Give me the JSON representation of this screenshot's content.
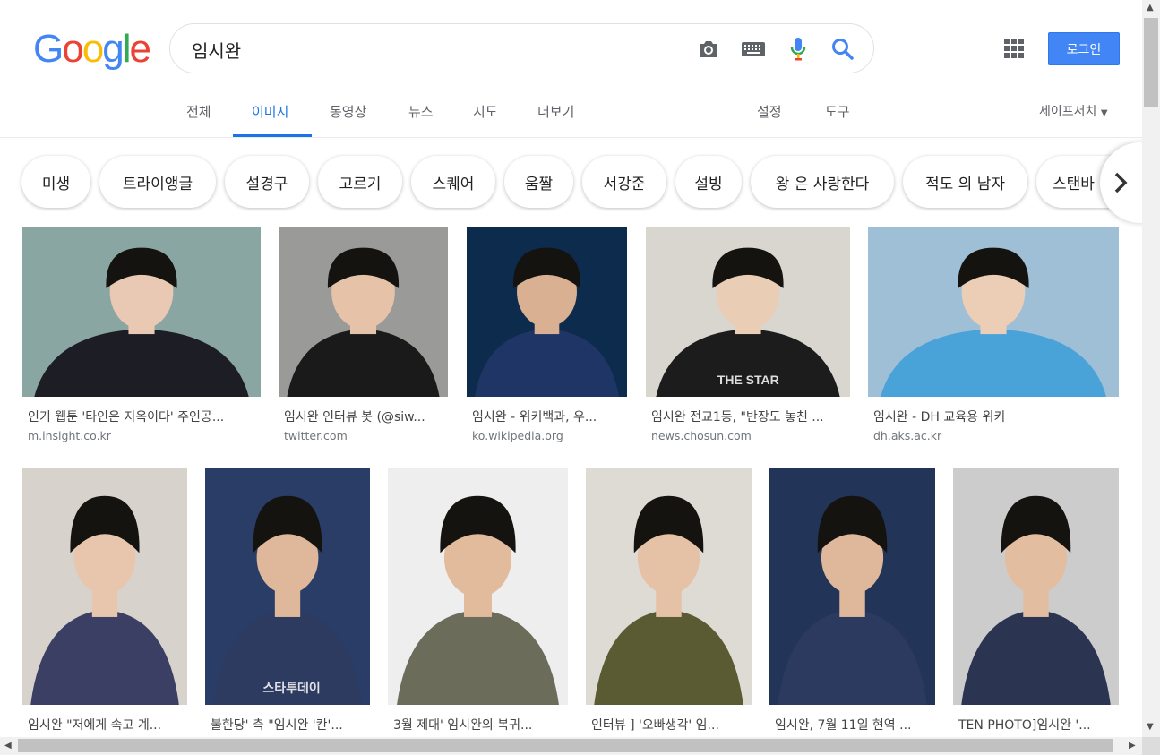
{
  "logo": {
    "letters": [
      "G",
      "o",
      "o",
      "g",
      "l",
      "e"
    ],
    "colors": [
      "#4285f4",
      "#ea4335",
      "#fbbc05",
      "#4285f4",
      "#34a853",
      "#ea4335"
    ]
  },
  "search": {
    "query": "임시완",
    "icons": [
      "camera-icon",
      "keyboard-icon",
      "microphone-icon",
      "search-icon"
    ]
  },
  "header": {
    "login_label": "로그인"
  },
  "tabs": [
    {
      "label": "전체",
      "active": false
    },
    {
      "label": "이미지",
      "active": true
    },
    {
      "label": "동영상",
      "active": false
    },
    {
      "label": "뉴스",
      "active": false
    },
    {
      "label": "지도",
      "active": false
    },
    {
      "label": "더보기",
      "active": false
    }
  ],
  "tools": {
    "settings": "설정",
    "tools": "도구",
    "safesearch": "세이프서치"
  },
  "chips": [
    "미생",
    "트라이앵글",
    "설경구",
    "고르기",
    "스퀘어",
    "움짤",
    "서강준",
    "설빙",
    "왕 은 사랑한다",
    "적도 의 남자",
    "스탠바"
  ],
  "results_row1": [
    {
      "title": "인기 웹툰 '타인은 지옥이다' 주인공...",
      "source": "m.insight.co.kr",
      "palette": [
        "#8aa6a3",
        "#1d1d25",
        "#e9c9b3"
      ]
    },
    {
      "title": "임시완 인터뷰 봇 (@siw...",
      "source": "twitter.com",
      "palette": [
        "#9a9a98",
        "#1a1a1a",
        "#e6c2a9"
      ]
    },
    {
      "title": "임시완 - 위키백과, 우...",
      "source": "ko.wikipedia.org",
      "palette": [
        "#0d2b4c",
        "#1f3566",
        "#d9b092"
      ]
    },
    {
      "title": "임시완 전교1등, \"반장도 놓친 ...",
      "source": "news.chosun.com",
      "palette": [
        "#d9d5cf",
        "#1c1c1c",
        "#e9cdb5"
      ],
      "watermark": "THE STAR"
    },
    {
      "title": "임시완 - DH 교육용 위키",
      "source": "dh.aks.ac.kr",
      "palette": [
        "#9fbfd6",
        "#4aa3d8",
        "#eccdb5"
      ]
    }
  ],
  "results_row2": [
    {
      "title": "임시완 \"저에게 속고 계...",
      "palette": [
        "#d8d2cc",
        "#3b3f63",
        "#e8c6ad"
      ]
    },
    {
      "title": "불한당' 측 \"임시완 '칸'...",
      "palette": [
        "#2a3d66",
        "#2d3b60",
        "#dfb89c"
      ],
      "watermark": "스타투데이"
    },
    {
      "title": "3월 제대' 임시완의 복귀...",
      "palette": [
        "#eeeeee",
        "#6b6c5a",
        "#e2bb9d"
      ]
    },
    {
      "title": "인터뷰 ] '오빠생각' 임...",
      "palette": [
        "#dedad4",
        "#5a5a33",
        "#e5c1a5"
      ]
    },
    {
      "title": "임시완, 7월 11일 현역 ...",
      "palette": [
        "#223457",
        "#2c3a5f",
        "#dfb89b"
      ]
    },
    {
      "title": "TEN PHOTO]임시완 '...",
      "palette": [
        "#cccccc",
        "#2b3552",
        "#e2bda0"
      ]
    }
  ]
}
